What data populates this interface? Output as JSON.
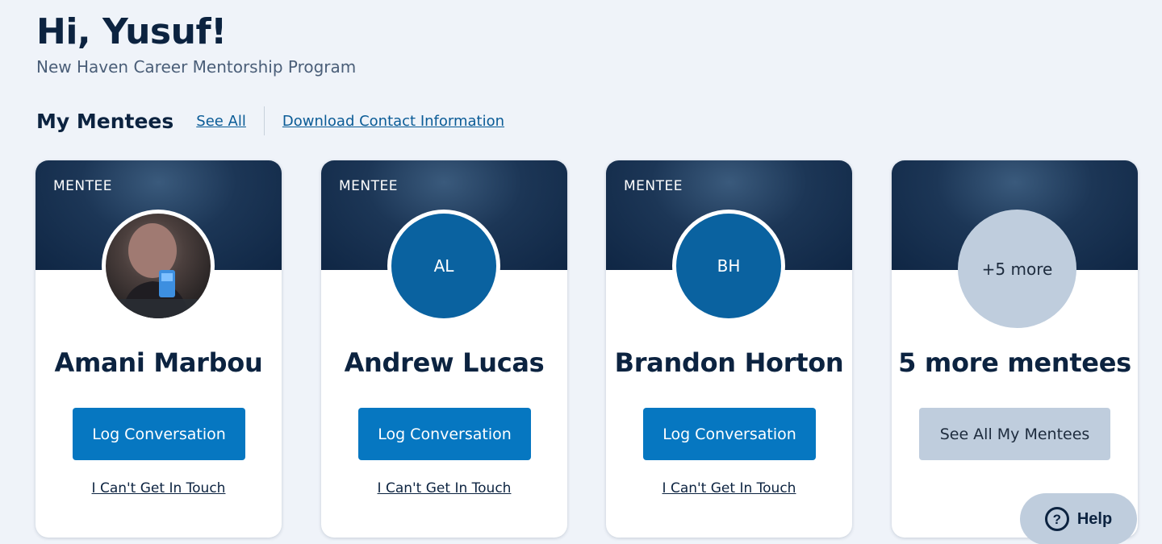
{
  "header": {
    "greeting": "Hi, Yusuf!",
    "program": "New Haven Career Mentorship Program"
  },
  "section": {
    "title": "My Mentees",
    "see_all": "See All",
    "download": "Download Contact Information"
  },
  "cards": [
    {
      "tag": "MENTEE",
      "avatar_type": "photo",
      "name": "Amani Marbou",
      "button": "Log Conversation",
      "link": "I Can't Get In Touch"
    },
    {
      "tag": "MENTEE",
      "avatar_type": "initials",
      "initials": "AL",
      "name": "Andrew Lucas",
      "button": "Log Conversation",
      "link": "I Can't Get In Touch"
    },
    {
      "tag": "MENTEE",
      "avatar_type": "initials",
      "initials": "BH",
      "name": "Brandon Horton",
      "button": "Log Conversation",
      "link": "I Can't Get In Touch"
    },
    {
      "avatar_type": "more",
      "more_label": "+5 more",
      "name": "5 more mentees",
      "button": "See All My Mentees"
    }
  ],
  "help": {
    "icon": "question-circle-icon",
    "label": "Help"
  },
  "colors": {
    "background": "#eff3f9",
    "navy": "#0c2340",
    "primary_button": "#0677c1",
    "avatar_blue": "#0a62a0",
    "muted_button": "#bfcddd",
    "link": "#0a5b96"
  }
}
